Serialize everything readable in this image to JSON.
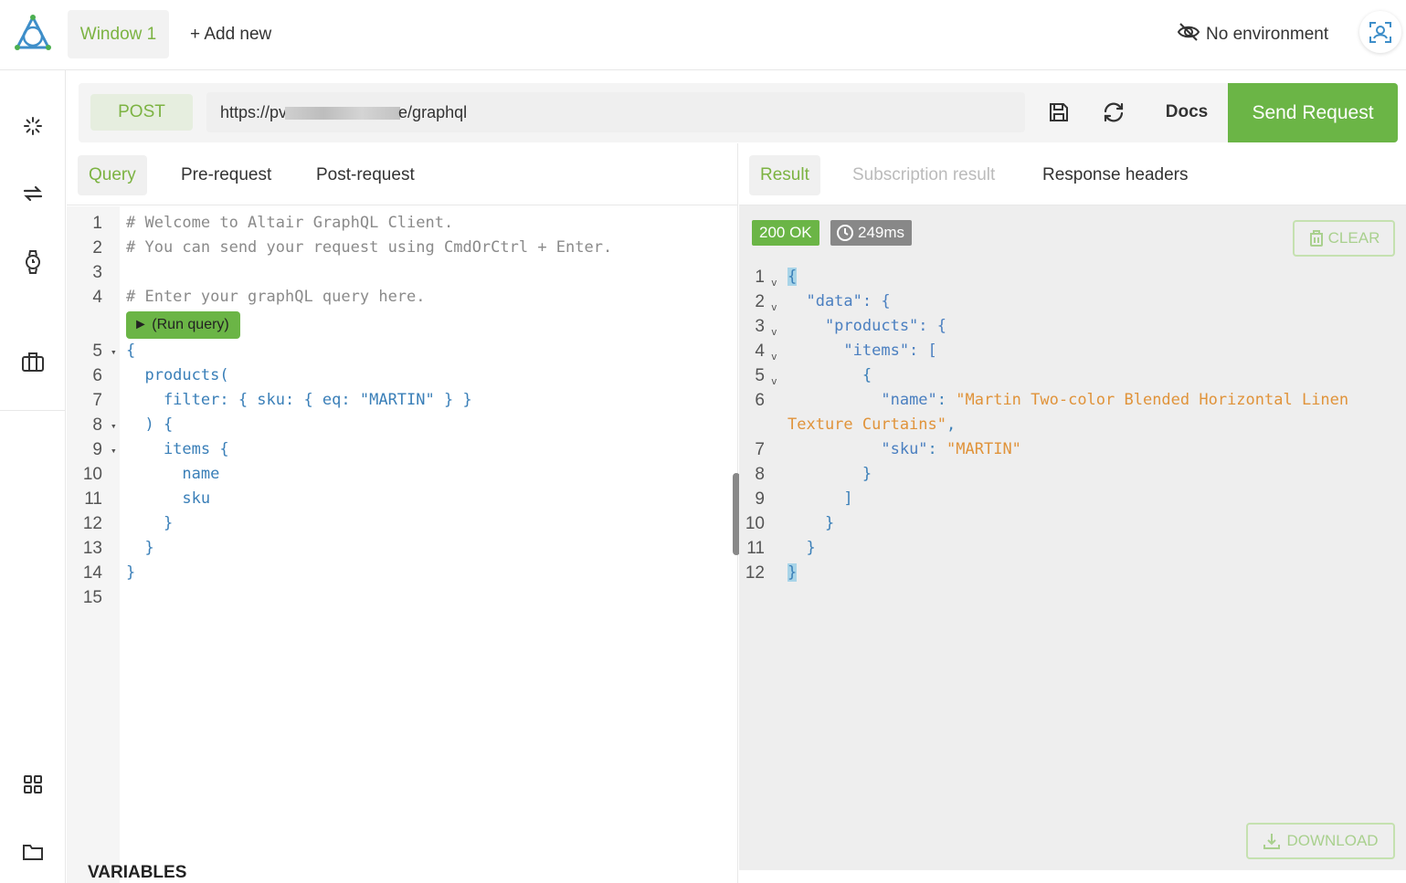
{
  "header": {
    "window_tab": "Window 1",
    "add_new": "+ Add new",
    "environment": "No environment"
  },
  "sidebar": {
    "icons": [
      "loader-icon",
      "sync-icon",
      "watch-icon",
      "briefcase-icon",
      "grid-icon",
      "folder-icon"
    ]
  },
  "request": {
    "method": "POST",
    "url_prefix": "https://pv",
    "url_suffix": "e/graphql",
    "docs_label": "Docs",
    "send_label": "Send Request"
  },
  "query_tabs": [
    "Query",
    "Pre-request",
    "Post-request"
  ],
  "query_lines": [
    {
      "n": "1",
      "text": "# Welcome to Altair GraphQL Client."
    },
    {
      "n": "2",
      "text": "# You can send your request using CmdOrCtrl + Enter."
    },
    {
      "n": "3",
      "text": ""
    },
    {
      "n": "4",
      "text": "# Enter your graphQL query here."
    },
    {
      "n": "5",
      "text": "{"
    },
    {
      "n": "6",
      "text": "  products("
    },
    {
      "n": "7",
      "text": "    filter: { sku: { eq: \"MARTIN\" } }"
    },
    {
      "n": "8",
      "text": "  ) {"
    },
    {
      "n": "9",
      "text": "    items {"
    },
    {
      "n": "10",
      "text": "      name"
    },
    {
      "n": "11",
      "text": "      sku"
    },
    {
      "n": "12",
      "text": "    }"
    },
    {
      "n": "13",
      "text": "  }"
    },
    {
      "n": "14",
      "text": "}"
    },
    {
      "n": "15",
      "text": ""
    }
  ],
  "run_query_label": "(Run query)",
  "variables_label": "VARIABLES",
  "result_tabs": [
    "Result",
    "Subscription result",
    "Response headers"
  ],
  "status": {
    "code": "200 OK",
    "time": "249ms",
    "clear_label": "CLEAR",
    "download_label": "DOWNLOAD"
  },
  "result_lines": [
    {
      "n": "1",
      "text": "{"
    },
    {
      "n": "2",
      "text": "  \"data\": {"
    },
    {
      "n": "3",
      "text": "    \"products\": {"
    },
    {
      "n": "4",
      "text": "      \"items\": ["
    },
    {
      "n": "5",
      "text": "        {"
    },
    {
      "n": "6",
      "key": "\"name\"",
      "value": "\"Martin Two-color Blended Horizontal Linen",
      "value2": "Texture Curtains\""
    },
    {
      "n": "7",
      "key": "\"sku\"",
      "value": "\"MARTIN\""
    },
    {
      "n": "8",
      "text": "        }"
    },
    {
      "n": "9",
      "text": "      ]"
    },
    {
      "n": "10",
      "text": "    }"
    },
    {
      "n": "11",
      "text": "  }"
    },
    {
      "n": "12",
      "text": "}"
    }
  ],
  "colors": {
    "accent": "#7cb342",
    "send_button": "#6bb546"
  }
}
